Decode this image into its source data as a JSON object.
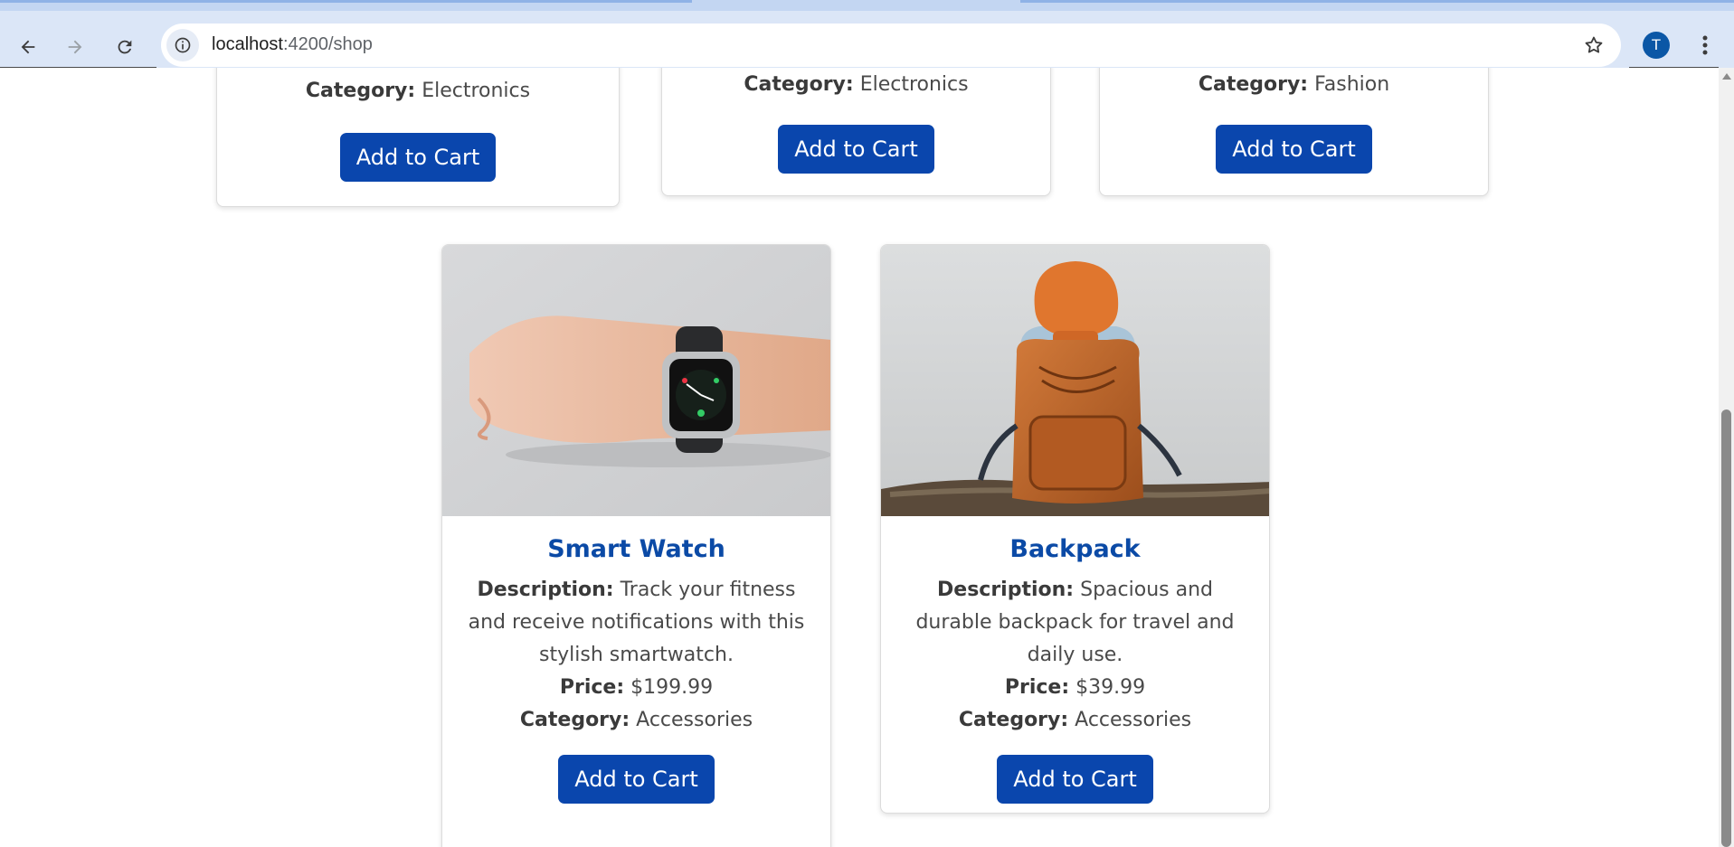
{
  "browser": {
    "url_host": "localhost",
    "url_path": ":4200/shop",
    "profile_initial": "T"
  },
  "products_top": [
    {
      "category_label": "Category:",
      "category": "Electronics",
      "button": "Add to Cart"
    },
    {
      "category_label": "Category:",
      "category": "Electronics",
      "button": "Add to Cart"
    },
    {
      "category_label": "Category:",
      "category": "Fashion",
      "button": "Add to Cart"
    }
  ],
  "products": [
    {
      "name": "Smart Watch",
      "description_label": "Description:",
      "description": "Track your fitness and receive notifications with this stylish smartwatch.",
      "price_label": "Price:",
      "price": "$199.99",
      "category_label": "Category:",
      "category": "Accessories",
      "button": "Add to Cart"
    },
    {
      "name": "Backpack",
      "description_label": "Description:",
      "description": "Spacious and durable backpack for travel and daily use.",
      "price_label": "Price:",
      "price": "$39.99",
      "category_label": "Category:",
      "category": "Accessories",
      "button": "Add to Cart"
    }
  ],
  "colors": {
    "accent": "#0a46ad",
    "title": "#0b4aa6",
    "chrome": "#dbe6f7"
  }
}
